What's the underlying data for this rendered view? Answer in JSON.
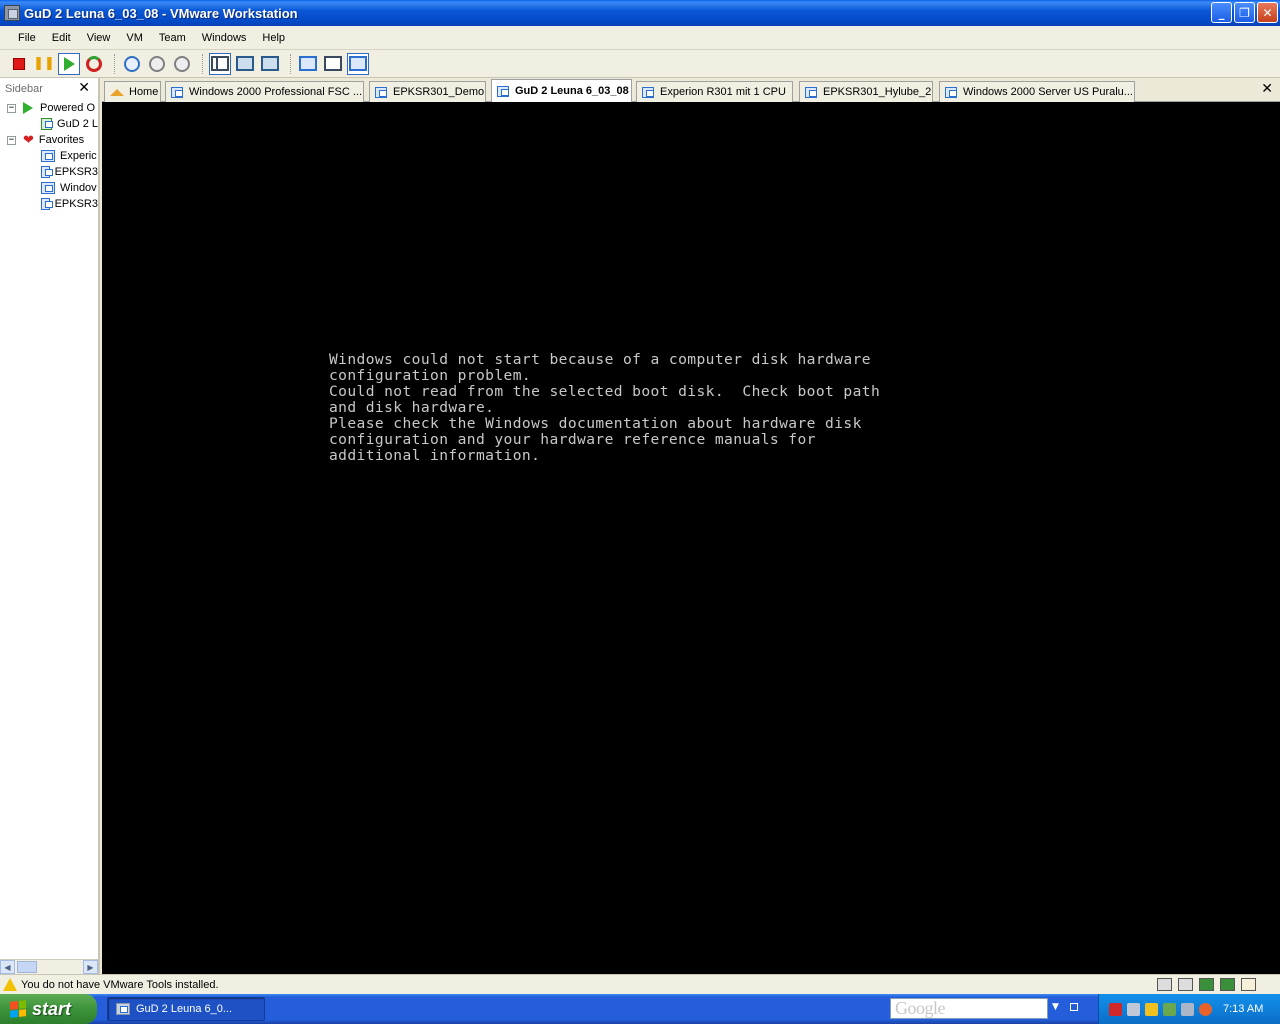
{
  "window": {
    "title": "GuD 2 Leuna 6_03_08 - VMware Workstation",
    "controls": {
      "minimize": "_",
      "restore": "❐",
      "close": "✕"
    }
  },
  "menu": [
    "File",
    "Edit",
    "View",
    "VM",
    "Team",
    "Windows",
    "Help"
  ],
  "toolbar": {
    "buttons": [
      "power-off",
      "suspend",
      "power-on",
      "reset",
      "snapshot",
      "revert-snapshot",
      "snapshot-manager",
      "quick-switch",
      "full-screen",
      "unity",
      "summary-view",
      "appliance-view",
      "console-view"
    ]
  },
  "sidebar": {
    "header": "Sidebar",
    "close": "✕",
    "groups": [
      {
        "label": "Powered O",
        "icon": "play-icon",
        "expander": "−",
        "children": [
          "GuD 2 L"
        ]
      },
      {
        "label": "Favorites",
        "icon": "heart-icon",
        "expander": "−",
        "children": [
          "Experic",
          "EPKSR3",
          "Windov",
          "EPKSR3"
        ]
      }
    ],
    "scroll_left": "◀",
    "scroll_right": "▶"
  },
  "tabs": {
    "items": [
      {
        "label": "Home",
        "icon": "home-icon",
        "active": false
      },
      {
        "label": "Windows 2000 Professional FSC ...",
        "icon": "vm-icon",
        "active": false
      },
      {
        "label": "EPKSR301_Demo",
        "icon": "vm-icon",
        "active": false
      },
      {
        "label": "GuD 2 Leuna 6_03_08",
        "icon": "vm-icon",
        "active": true
      },
      {
        "label": "Experion R301 mit 1 CPU",
        "icon": "vm-icon",
        "active": false
      },
      {
        "label": "EPKSR301_Hylube_2",
        "icon": "vm-icon",
        "active": false
      },
      {
        "label": "Windows 2000 Server US Puralu...",
        "icon": "vm-icon",
        "active": false
      }
    ],
    "close": "✕"
  },
  "console": {
    "lines": [
      "Windows could not start because of a computer disk hardware",
      "configuration problem.",
      "Could not read from the selected boot disk.  Check boot path",
      "and disk hardware.",
      "Please check the Windows documentation about hardware disk",
      "configuration and your hardware reference manuals for",
      "additional information."
    ]
  },
  "statusbar": {
    "message": "You do not have VMware Tools installed.",
    "devices": [
      "hard-disk-icon",
      "printer-icon",
      "network-icon",
      "network-icon",
      "usb-icon"
    ]
  },
  "taskbar": {
    "start": "start",
    "task": "GuD 2 Leuna 6_0...",
    "search_placeholder": "Google",
    "tray_icons": [
      "antivirus-icon",
      "network-icon",
      "shield-icon",
      "network-icon",
      "speaker-icon",
      "update-icon"
    ],
    "clock": "7:13 AM"
  }
}
